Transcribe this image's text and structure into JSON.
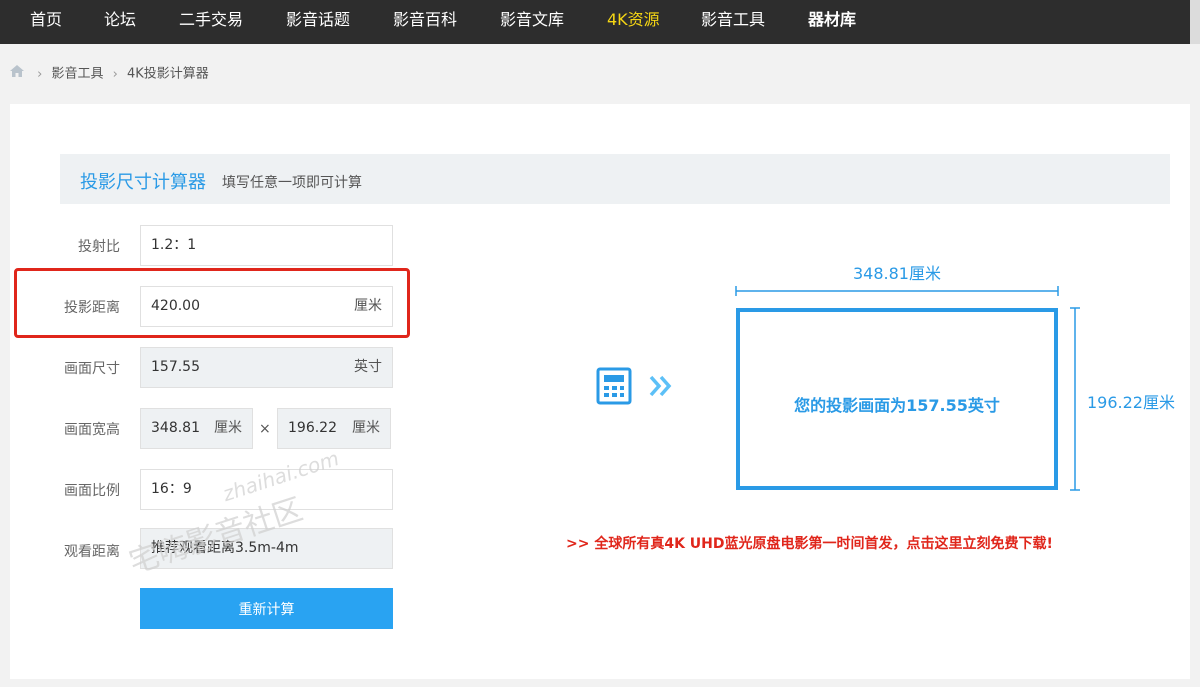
{
  "nav": {
    "items": [
      {
        "label": "首页"
      },
      {
        "label": "论坛"
      },
      {
        "label": "二手交易"
      },
      {
        "label": "影音话题"
      },
      {
        "label": "影音百科"
      },
      {
        "label": "影音文库"
      },
      {
        "label": "4K资源"
      },
      {
        "label": "影音工具"
      },
      {
        "label": "器材库"
      }
    ],
    "highlight_color": "#f5d614"
  },
  "breadcrumb": {
    "icon": "home-icon",
    "items": [
      "影音工具",
      "4K投影计算器"
    ],
    "separator": "›"
  },
  "calculator": {
    "title": "投影尺寸计算器",
    "subtitle": "填写任意一项即可计算",
    "throw_ratio": {
      "label": "投射比",
      "value": "1.2：1"
    },
    "distance": {
      "label": "投影距离",
      "value": "420.00",
      "unit": "厘米"
    },
    "screen_size": {
      "label": "画面尺寸",
      "value": "157.55",
      "unit": "英寸"
    },
    "dimensions": {
      "label": "画面宽高",
      "width": "348.81",
      "width_unit": "厘米",
      "times": "×",
      "height": "196.22",
      "height_unit": "厘米"
    },
    "aspect": {
      "label": "画面比例",
      "value": "16：9"
    },
    "viewing": {
      "label": "观看距离",
      "value": "推荐观看距离3.5m-4m"
    },
    "recalc_label": "重新计算"
  },
  "preview": {
    "width_label": "348.81厘米",
    "height_label": "196.22厘米",
    "screen_text": "您的投影画面为157.55英寸",
    "accent": "#2a9ae6"
  },
  "promo": ">> 全球所有真4K UHD蓝光原盘电影第一时间首发，点击这里立刻免费下载!",
  "watermark": {
    "line1": "zhaihai.com",
    "line2": "宅嗨影音社区"
  }
}
